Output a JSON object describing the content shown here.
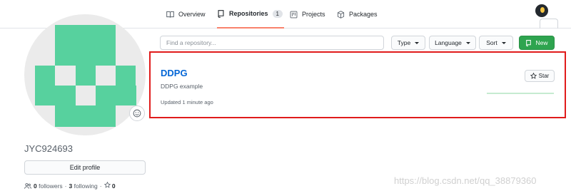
{
  "nav": {
    "tabs": [
      {
        "label": "Overview",
        "icon": "book-icon"
      },
      {
        "label": "Repositories",
        "count": "1",
        "icon": "repo-icon",
        "active": true
      },
      {
        "label": "Projects",
        "icon": "project-icon"
      },
      {
        "label": "Packages",
        "icon": "package-icon"
      }
    ],
    "active_underline_color": "#f9826c"
  },
  "profile": {
    "username": "JYC924693",
    "edit_label": "Edit profile",
    "followers_count": "0",
    "followers_label": "followers",
    "following_count": "3",
    "following_label": "following",
    "stars_count": "0",
    "avatar_color": "#57d19e"
  },
  "filters": {
    "search_placeholder": "Find a repository...",
    "type_label": "Type",
    "language_label": "Language",
    "sort_label": "Sort",
    "new_label": "New",
    "new_color": "#2ea44f"
  },
  "repo": {
    "name": "DDPG",
    "description": "DDPG example",
    "updated": "Updated 1 minute ago",
    "star_label": "Star",
    "name_color": "#0366d6",
    "highlight_color": "#e01b1b"
  },
  "watermark": "https://blog.csdn.net/qq_38879360"
}
